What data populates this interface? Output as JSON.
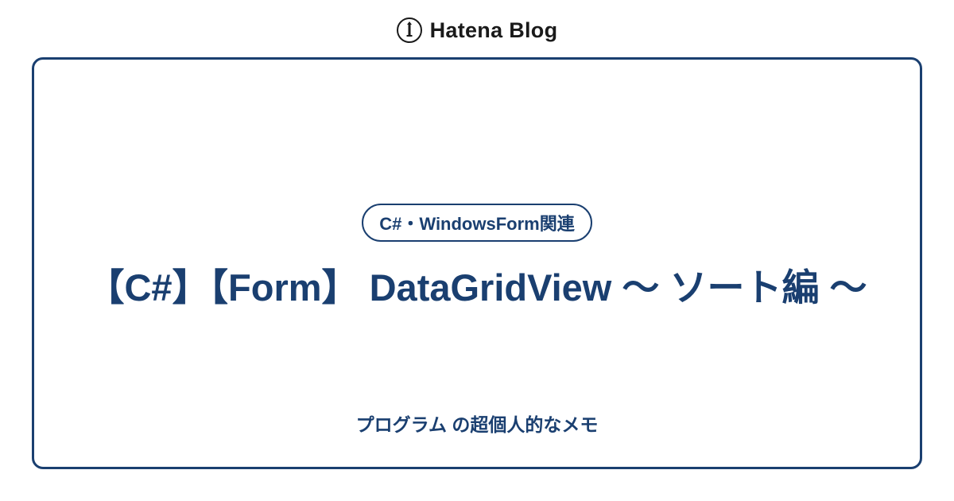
{
  "brand": {
    "name": "Hatena Blog"
  },
  "card": {
    "category": "C#・WindowsForm関連",
    "title": "【C#】【Form】 DataGridView ～ ソート編 ～",
    "blog_name": "プログラム の超個人的なメモ"
  },
  "colors": {
    "primary": "#1a3f70",
    "background": "#ffffff"
  }
}
